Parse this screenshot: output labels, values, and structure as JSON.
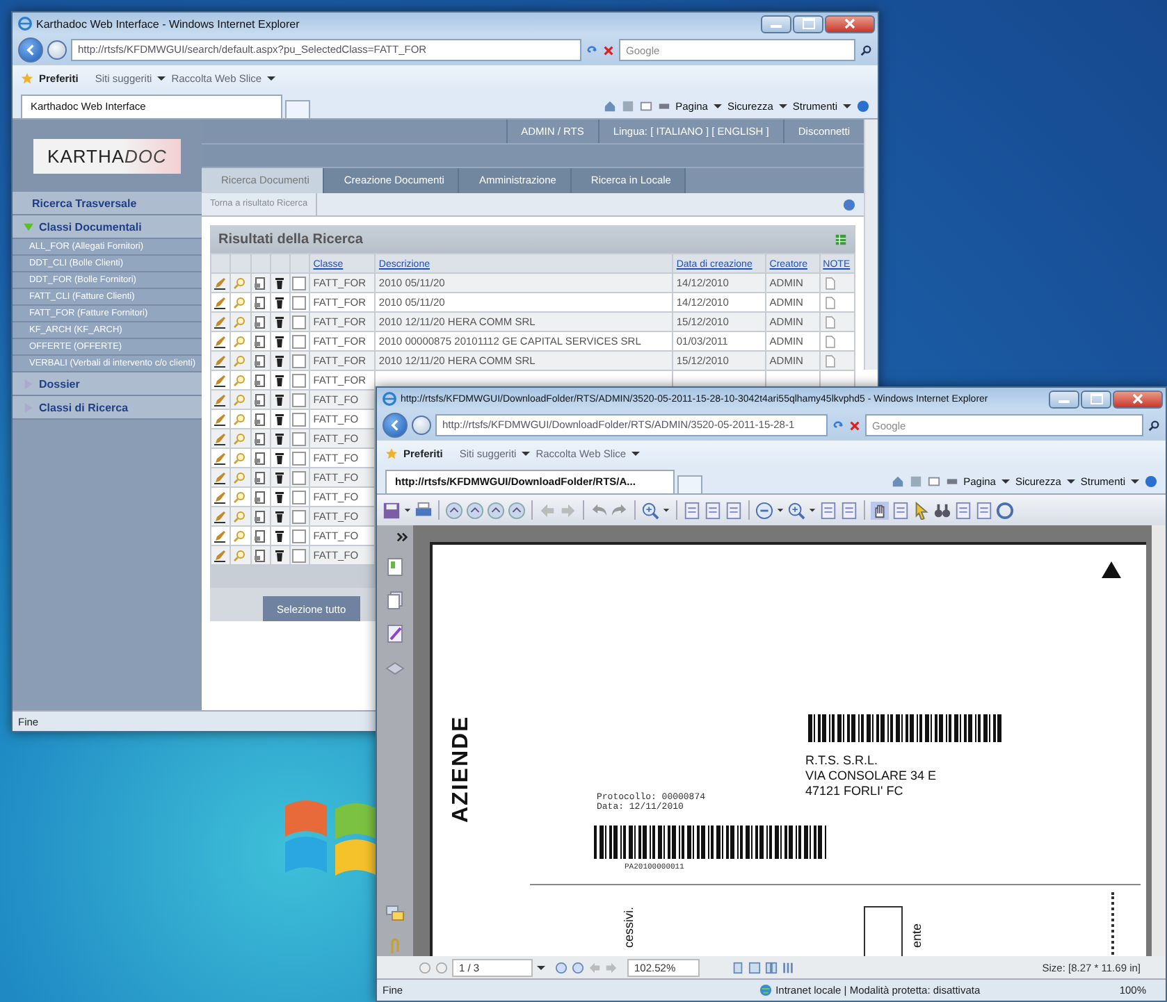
{
  "back_window": {
    "title": "Karthadoc Web Interface - Windows Internet Explorer",
    "address": "http://rtsfs/KFDMWGUI/search/default.aspx?pu_SelectedClass=FATT_FOR",
    "search_placeholder": "Google",
    "favorites_bar": {
      "title": "Preferiti",
      "links": [
        "Siti suggeriti",
        "Raccolta Web Slice"
      ]
    },
    "tab": "Karthadoc Web Interface",
    "command_bar": [
      "Pagina",
      "Sicurezza",
      "Strumenti"
    ],
    "app": {
      "logo": {
        "text": "KARTHA",
        "accent": "DOC"
      },
      "user": "ADMIN / RTS",
      "language": "Lingua: [ ITALIANO ] [ ENGLISH ]",
      "logout": "Disconnetti",
      "nav_tabs": [
        {
          "label": "Ricerca Documenti",
          "selected": true
        },
        {
          "label": "Creazione Documenti",
          "selected": false
        },
        {
          "label": "Amministrazione",
          "selected": false
        },
        {
          "label": "Ricerca in Locale",
          "selected": false
        }
      ],
      "back_link": "Torna a risultato Ricerca",
      "sidebar": [
        {
          "label": "Ricerca Trasversale",
          "kind": "link"
        },
        {
          "label": "Classi Documentali",
          "kind": "group",
          "expanded": true,
          "children": [
            "ALL_FOR (Allegati Fornitori)",
            "DDT_CLI (Bolle Clienti)",
            "DDT_FOR (Bolle Fornitori)",
            "FATT_CLI (Fatture Clienti)",
            "FATT_FOR (Fatture Fornitori)",
            "KF_ARCH (KF_ARCH)",
            "OFFERTE (OFFERTE)",
            "VERBALI (Verbali di intervento c/o clienti)"
          ]
        },
        {
          "label": "Dossier",
          "kind": "group",
          "expanded": false
        },
        {
          "label": "Classi di Ricerca",
          "kind": "group",
          "expanded": false
        }
      ],
      "results": {
        "title": "Risultati della Ricerca",
        "columns": [
          "Classe",
          "Descrizione",
          "Data di creazione",
          "Creatore",
          "NOTE"
        ],
        "rows": [
          {
            "classe": "FATT_FOR",
            "descrizione": "2010 05/11/20",
            "data": "14/12/2010",
            "creatore": "ADMIN",
            "checked": false
          },
          {
            "classe": "FATT_FOR",
            "descrizione": "2010 05/11/20",
            "data": "14/12/2010",
            "creatore": "ADMIN",
            "checked": false
          },
          {
            "classe": "FATT_FOR",
            "descrizione": "2010 12/11/20 HERA COMM SRL",
            "data": "15/12/2010",
            "creatore": "ADMIN",
            "checked": false
          },
          {
            "classe": "FATT_FOR",
            "descrizione": "2010 00000875 20101112 GE CAPITAL SERVICES SRL",
            "data": "01/03/2011",
            "creatore": "ADMIN",
            "checked": false
          },
          {
            "classe": "FATT_FOR",
            "descrizione": "2010 12/11/20 HERA COMM SRL",
            "data": "15/12/2010",
            "creatore": "ADMIN",
            "checked": false
          },
          {
            "classe": "FATT_FOR",
            "checked": false
          },
          {
            "classe": "FATT_FO",
            "checked": false
          },
          {
            "classe": "FATT_FO",
            "checked": false
          },
          {
            "classe": "FATT_FO",
            "checked": false
          },
          {
            "classe": "FATT_FO",
            "checked": false
          },
          {
            "classe": "FATT_FO",
            "checked": false
          },
          {
            "classe": "FATT_FO",
            "checked": false
          },
          {
            "classe": "FATT_FO",
            "checked": false
          },
          {
            "classe": "FATT_FO",
            "checked": false
          },
          {
            "classe": "FATT_FO",
            "checked": false
          }
        ],
        "select_all_button": "Selezione tutto"
      }
    },
    "status": "Fine"
  },
  "front_window": {
    "title": "http://rtsfs/KFDMWGUI/DownloadFolder/RTS/ADMIN/3520-05-2011-15-28-10-3042t4ari55qlhamy45lkvphd5 - Windows Internet Explorer",
    "address": "http://rtsfs/KFDMWGUI/DownloadFolder/RTS/ADMIN/3520-05-2011-15-28-1",
    "search_placeholder": "Google",
    "favorites_bar": {
      "title": "Preferiti",
      "links": [
        "Siti suggeriti",
        "Raccolta Web Slice"
      ]
    },
    "tab": "http://rtsfs/KFDMWGUI/DownloadFolder/RTS/A...",
    "command_bar": [
      "Pagina",
      "Sicurezza",
      "Strumenti"
    ],
    "document": {
      "side_label": "AZIENDE",
      "protocol": "Protocollo: 00000874",
      "date": "Data: 12/11/2010",
      "barcode_number": "PA20100000011",
      "address_lines": [
        "R.T.S. S.R.L.",
        "VIA CONSOLARE 34 E",
        "47121 FORLI' FC"
      ],
      "bottom_texts": [
        "cessivi.",
        "ente"
      ]
    },
    "pdf_nav": {
      "page": "1 / 3",
      "zoom": "102.52%",
      "size": "Size: [8.27 * 11.69 in]"
    },
    "status": {
      "text": "Fine",
      "zone": "Intranet locale | Modalità protetta: disattivata",
      "zoom": "100%"
    }
  }
}
